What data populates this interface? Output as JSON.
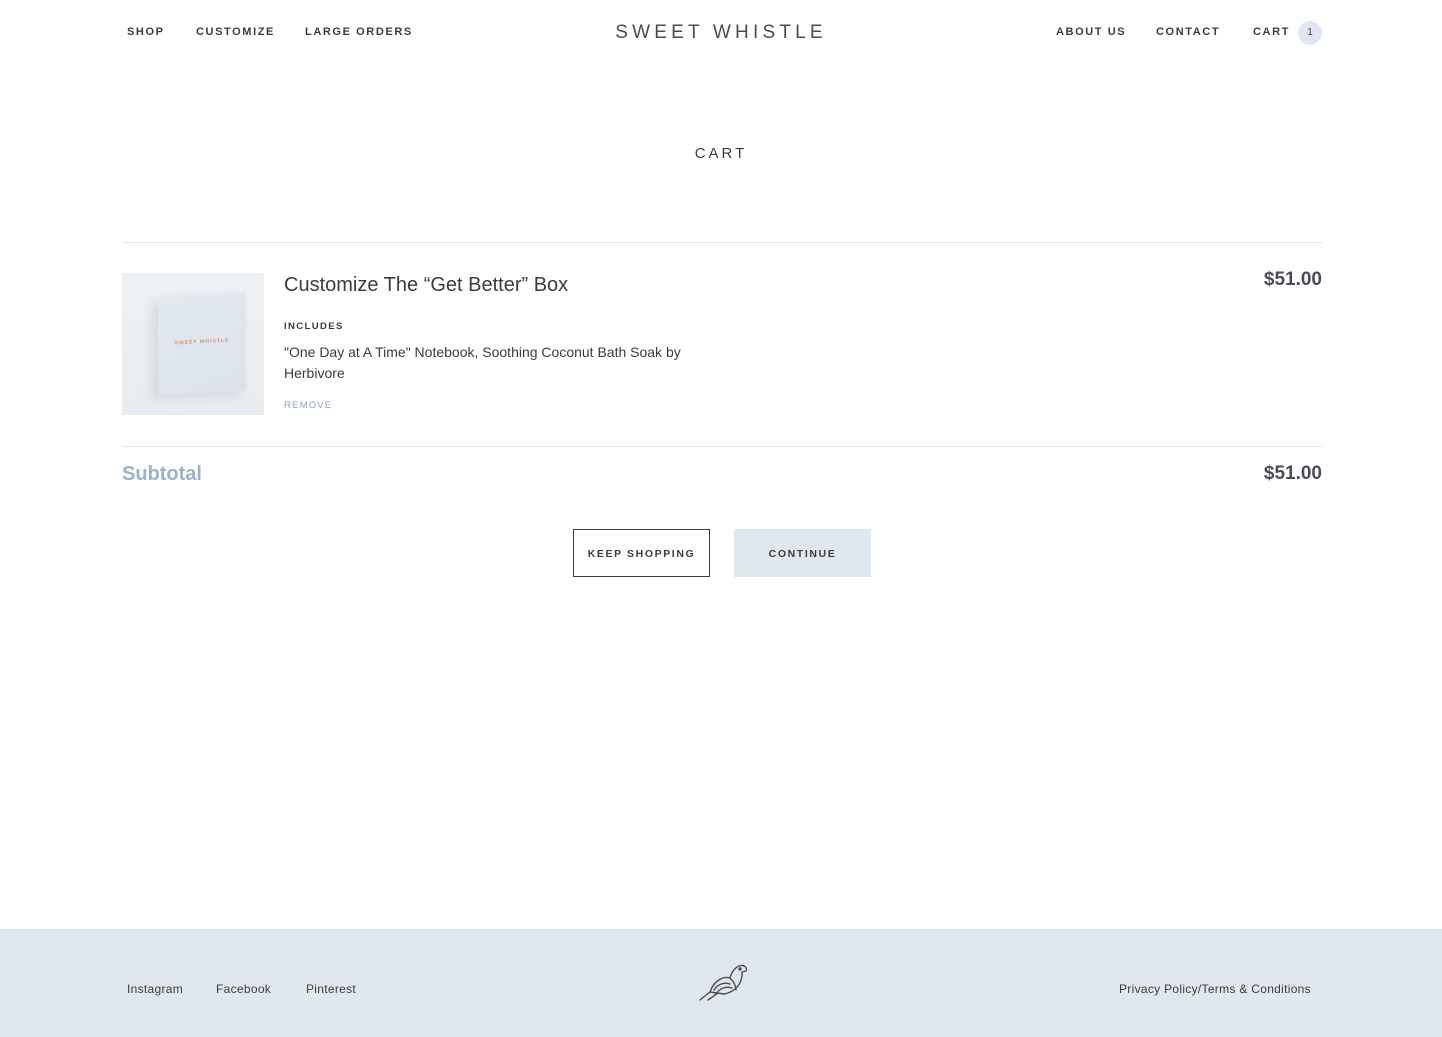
{
  "header": {
    "nav_left": [
      {
        "label": "SHOP"
      },
      {
        "label": "CUSTOMIZE"
      },
      {
        "label": "LARGE ORDERS"
      }
    ],
    "logo": "SWEET WHISTLE",
    "nav_right": [
      {
        "label": "ABOUT US"
      },
      {
        "label": "CONTACT"
      },
      {
        "label": "CART"
      }
    ],
    "cart_count": "1"
  },
  "page_title": "CART",
  "cart": {
    "items": [
      {
        "title": "Customize The “Get Better” Box",
        "includes_label": "INCLUDES",
        "includes_text": "\"One Day at A Time\" Notebook, Soothing Coconut Bath Soak by Herbivore",
        "remove_label": "REMOVE",
        "price": "$51.00",
        "image_brand_text": "SWEET WHISTLE"
      }
    ],
    "subtotal_label": "Subtotal",
    "subtotal_value": "$51.00"
  },
  "buttons": {
    "keep_shopping": "KEEP SHOPPING",
    "continue": "CONTINUE"
  },
  "footer": {
    "links": [
      {
        "label": "Instagram"
      },
      {
        "label": "Facebook"
      },
      {
        "label": "Pinterest"
      }
    ],
    "legal": "Privacy Policy/Terms & Conditions",
    "logo_icon": "bird-icon"
  },
  "colors": {
    "accent_light": "#e1e7f1",
    "subtotal_blue": "#9fb0cb",
    "text_dark": "#3b3b45"
  }
}
